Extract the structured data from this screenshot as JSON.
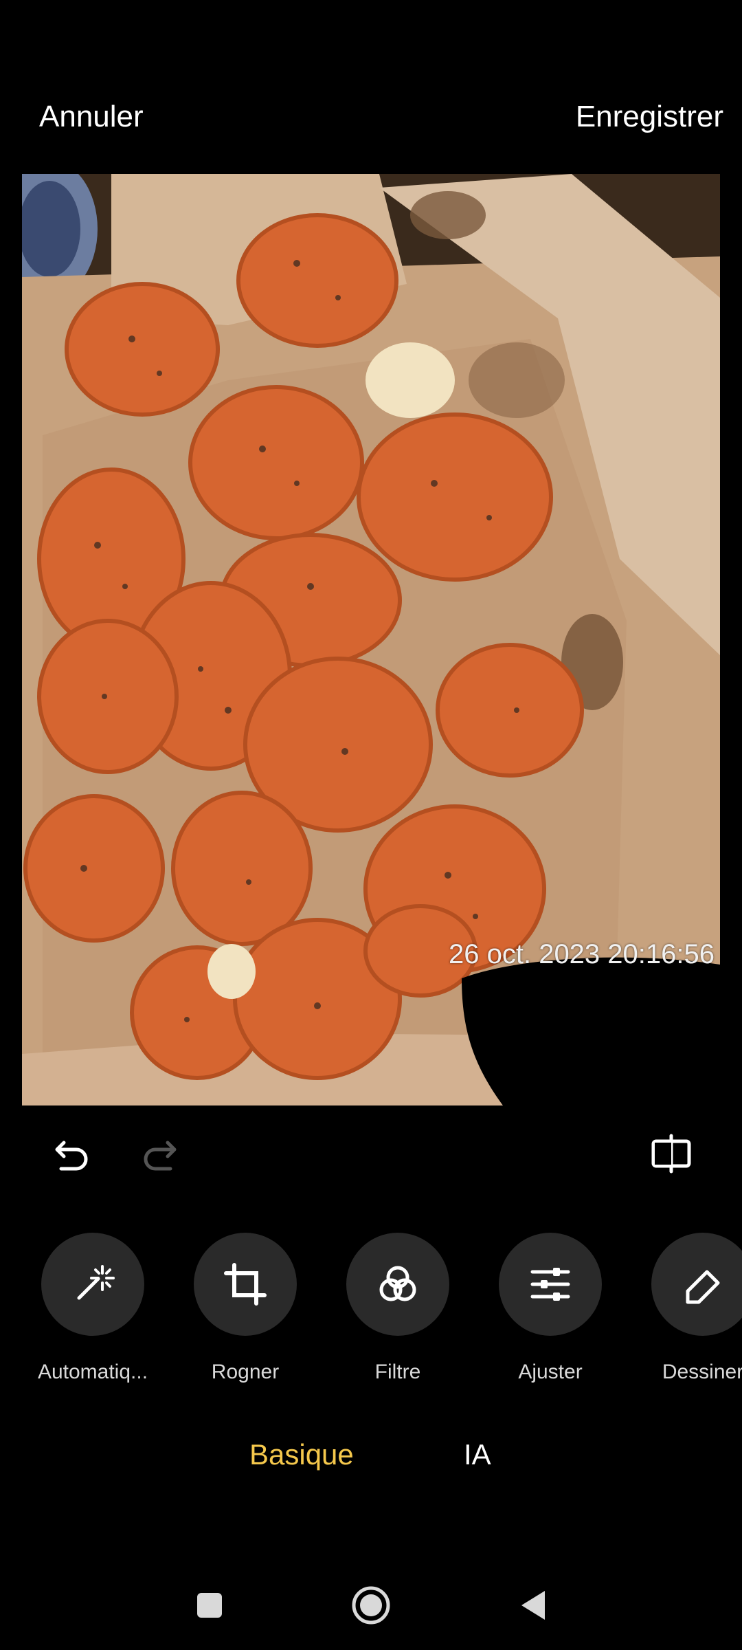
{
  "topbar": {
    "cancel_label": "Annuler",
    "save_label": "Enregistrer"
  },
  "photo": {
    "timestamp": "26 oct. 2023 20:16:56",
    "subject": "crispy-chicken-pieces-in-box"
  },
  "edit_controls": {
    "undo_icon": "undo-icon",
    "redo_icon": "redo-icon",
    "compare_icon": "compare-icon",
    "redo_enabled": false
  },
  "tools": [
    {
      "label": "Automatiq...",
      "icon": "auto-enhance-icon"
    },
    {
      "label": "Rogner",
      "icon": "crop-icon"
    },
    {
      "label": "Filtre",
      "icon": "filter-icon"
    },
    {
      "label": "Ajuster",
      "icon": "adjust-sliders-icon"
    },
    {
      "label": "Dessiner",
      "icon": "draw-eraser-icon"
    }
  ],
  "modes": {
    "basic": "Basique",
    "ai": "IA",
    "active": "basic",
    "active_color": "#f5c84c"
  },
  "navbar": {
    "recent_icon": "square-icon",
    "home_icon": "circle-icon",
    "back_icon": "triangle-back-icon"
  }
}
